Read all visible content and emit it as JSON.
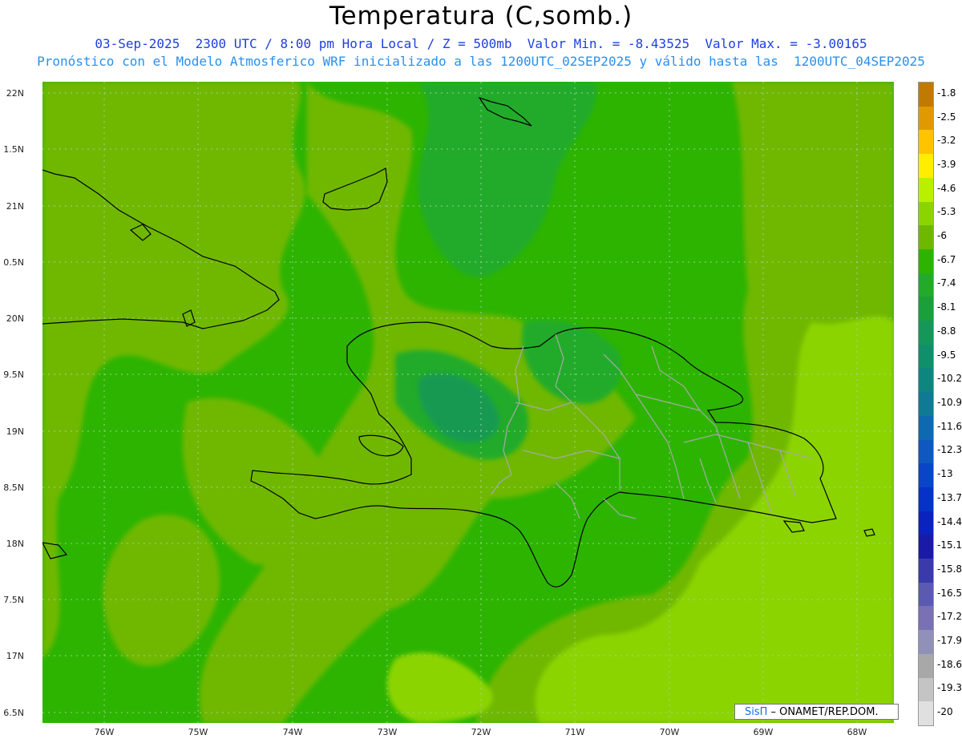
{
  "title": "Temperatura (C,somb.)",
  "subtitle_line1": "03-Sep-2025  2300 UTC / 8:00 pm Hora Local / Z = 500mb  Valor Min. = -8.43525  Valor Max. = -3.00165",
  "subtitle_line2": "Pronóstico con el Modelo Atmosferico WRF inicializado a las 1200UTC_02SEP2025 y válido hasta las  1200UTC_04SEP2025",
  "y_ticks": [
    "22N",
    "1.5N",
    "21N",
    "0.5N",
    "20N",
    "9.5N",
    "19N",
    "8.5N",
    "18N",
    "7.5N",
    "17N",
    "6.5N"
  ],
  "x_ticks": [
    "76W",
    "75W",
    "74W",
    "73W",
    "72W",
    "71W",
    "70W",
    "69W",
    "68W"
  ],
  "colorbar": {
    "labels": [
      "-1.8",
      "-2.5",
      "-3.2",
      "-3.9",
      "-4.6",
      "-5.3",
      "-6",
      "-6.7",
      "-7.4",
      "-8.1",
      "-8.8",
      "-9.5",
      "-10.2",
      "-10.9",
      "-11.6",
      "-12.3",
      "-13",
      "-13.7",
      "-14.4",
      "-15.1",
      "-15.8",
      "-16.5",
      "-17.2",
      "-17.9",
      "-18.6",
      "-19.3",
      "-20"
    ],
    "colors": [
      "#c07a00",
      "#e09a00",
      "#ffc400",
      "#ffee00",
      "#b8f000",
      "#8cd400",
      "#6fb800",
      "#2db400",
      "#22ab2a",
      "#1aa03a",
      "#15975a",
      "#10906a",
      "#0e8680",
      "#0e7a94",
      "#0e6ab0",
      "#0e58c0",
      "#0a44c8",
      "#0632c8",
      "#0a22bf",
      "#1a1aa8",
      "#3a3aac",
      "#5a5ab0",
      "#7a70b4",
      "#9090b8",
      "#a8a8a8",
      "#c4c4c4",
      "#e0e0e0"
    ]
  },
  "credit": {
    "brand": "SisΠ",
    "text": " – ONAMET/REP.DOM."
  },
  "field_colors": {
    "light_green": "#8cd400",
    "mid_green": "#6fb800",
    "green": "#2db400",
    "dark_green": "#22ab2a",
    "teal": "#15975a",
    "yellow_green": "#b8f000"
  },
  "map_features": [
    "coastline",
    "provincial-borders",
    "lat-lon-grid"
  ]
}
